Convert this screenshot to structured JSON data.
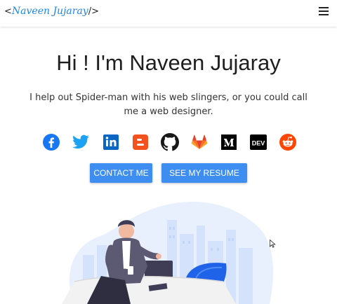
{
  "nav": {
    "logo_open": "<",
    "logo_name": "Naveen Jujaray",
    "logo_close": "/>",
    "menu_icon": "hamburger-icon"
  },
  "hero": {
    "title": "Hi ! I'm Naveen Jujaray",
    "tagline": "I help out Spider-man with his web slingers, or you could call me a web designer."
  },
  "socials": [
    {
      "name": "facebook-icon",
      "color": "#1877f2"
    },
    {
      "name": "twitter-icon",
      "color": "#1da1f2"
    },
    {
      "name": "linkedin-icon",
      "color": "#0a66c2"
    },
    {
      "name": "blogger-icon",
      "color": "#f4511e"
    },
    {
      "name": "github-icon",
      "color": "#181717"
    },
    {
      "name": "gitlab-icon",
      "color": "#fc6d26"
    },
    {
      "name": "medium-icon",
      "color": "#000000"
    },
    {
      "name": "dev-icon",
      "color": "#000000",
      "label": "DEV"
    },
    {
      "name": "reddit-icon",
      "color": "#ff4500"
    }
  ],
  "buttons": {
    "contact": "CONTACT ME",
    "resume": "SEE MY RESUME"
  },
  "colors": {
    "accent": "#3d8ef0",
    "logo_name": "#1e88e5"
  }
}
